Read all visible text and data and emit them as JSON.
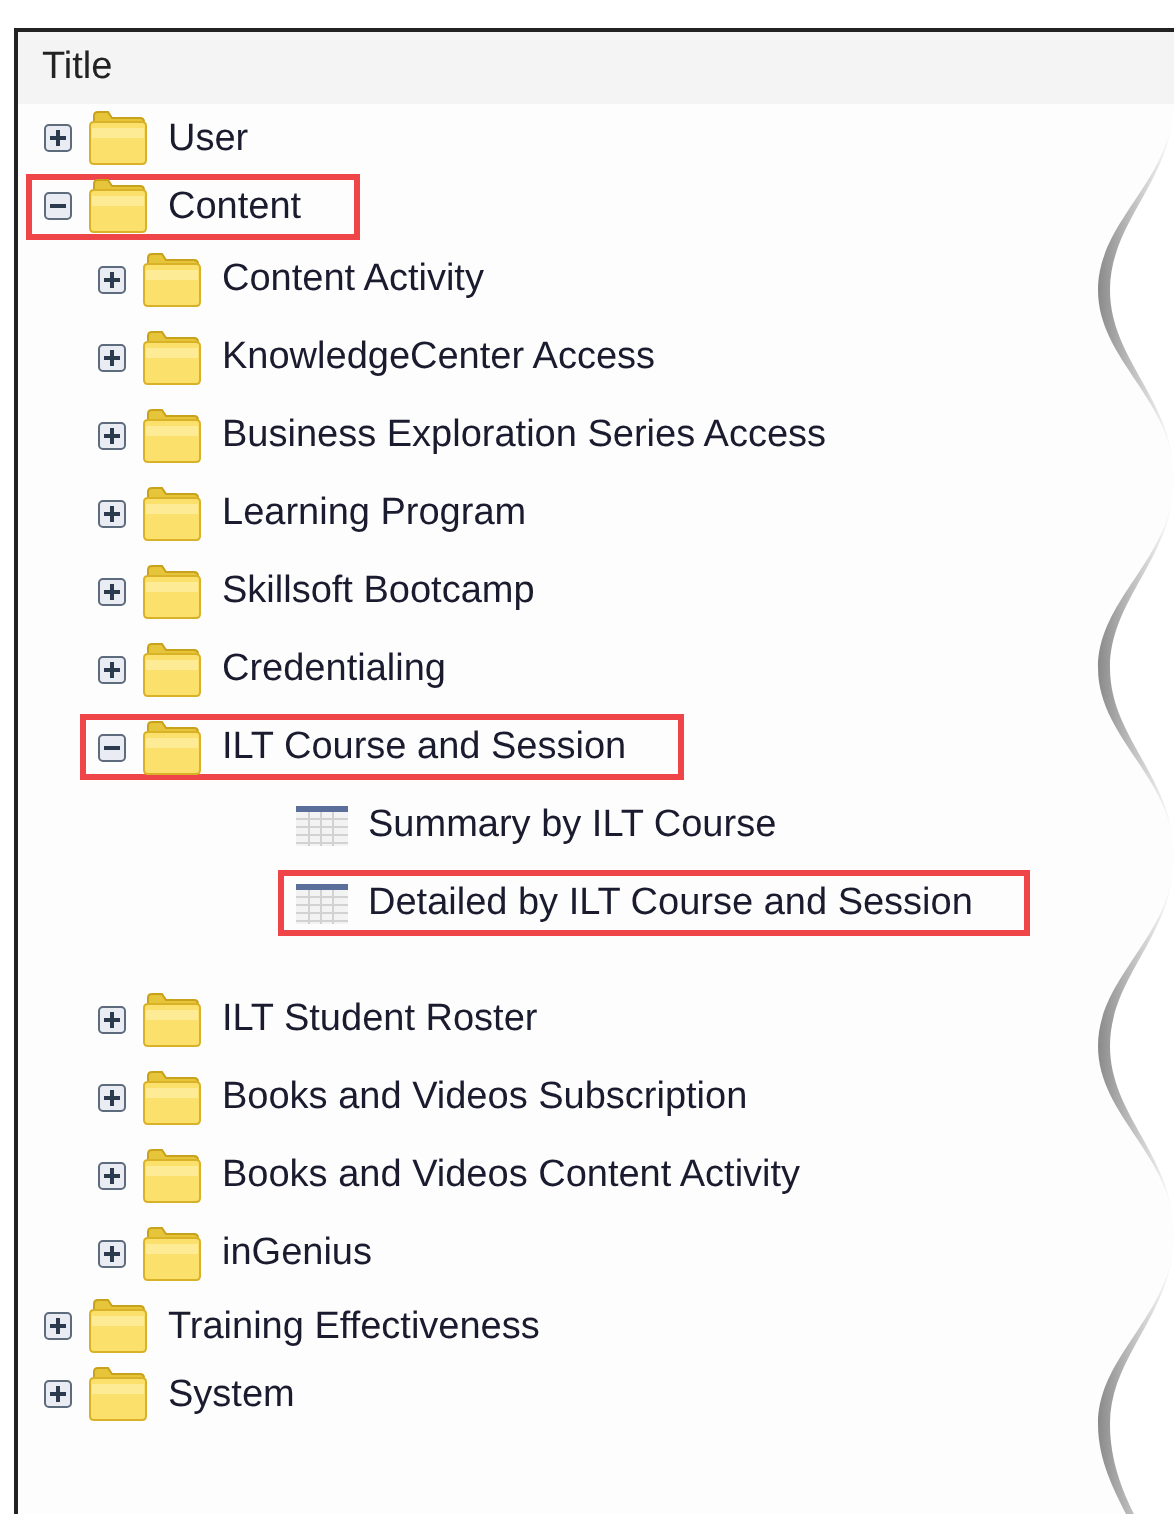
{
  "header": {
    "title": "Title"
  },
  "tree": [
    {
      "label": "User",
      "kind": "folder",
      "expanded": false,
      "highlighted": false
    },
    {
      "label": "Content",
      "kind": "folder",
      "expanded": true,
      "highlighted": true,
      "children": [
        {
          "label": "Content Activity",
          "kind": "folder",
          "expanded": false,
          "highlighted": false
        },
        {
          "label": "KnowledgeCenter Access",
          "kind": "folder",
          "expanded": false,
          "highlighted": false
        },
        {
          "label": "Business Exploration Series Access",
          "kind": "folder",
          "expanded": false,
          "highlighted": false
        },
        {
          "label": "Learning Program",
          "kind": "folder",
          "expanded": false,
          "highlighted": false
        },
        {
          "label": "Skillsoft Bootcamp",
          "kind": "folder",
          "expanded": false,
          "highlighted": false
        },
        {
          "label": "Credentialing",
          "kind": "folder",
          "expanded": false,
          "highlighted": false
        },
        {
          "label": "ILT Course and Session",
          "kind": "folder",
          "expanded": true,
          "highlighted": true,
          "children": [
            {
              "label": "Summary by ILT Course",
              "kind": "report",
              "highlighted": false
            },
            {
              "label": "Detailed by ILT Course and Session",
              "kind": "report",
              "highlighted": true
            }
          ]
        },
        {
          "label": "ILT Student Roster",
          "kind": "folder",
          "expanded": false,
          "highlighted": false
        },
        {
          "label": "Books and Videos Subscription",
          "kind": "folder",
          "expanded": false,
          "highlighted": false
        },
        {
          "label": "Books and Videos Content Activity",
          "kind": "folder",
          "expanded": false,
          "highlighted": false
        },
        {
          "label": "inGenius",
          "kind": "folder",
          "expanded": false,
          "highlighted": false
        }
      ]
    },
    {
      "label": "Training Effectiveness",
      "kind": "folder",
      "expanded": false,
      "highlighted": false
    },
    {
      "label": "System",
      "kind": "folder",
      "expanded": false,
      "highlighted": false
    }
  ]
}
